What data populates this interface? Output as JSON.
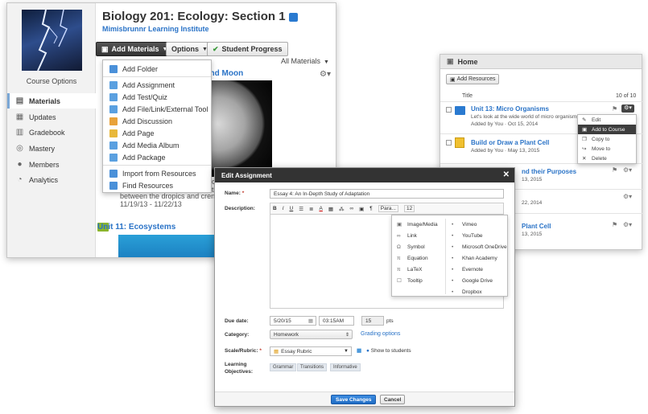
{
  "course": {
    "title": "Biology 201: Ecology: Section 1",
    "school": "Mimisbrunnr Learning Institute",
    "options_label": "Course Options",
    "nav": [
      {
        "label": "Materials",
        "icon": "materials-icon"
      },
      {
        "label": "Updates",
        "icon": "updates-icon"
      },
      {
        "label": "Gradebook",
        "icon": "gradebook-icon"
      },
      {
        "label": "Mastery",
        "icon": "mastery-icon"
      },
      {
        "label": "Members",
        "icon": "members-icon"
      },
      {
        "label": "Analytics",
        "icon": "analytics-icon"
      }
    ],
    "toolbar": {
      "add_materials": "Add Materials",
      "options": "Options",
      "student_progress": "Student Progress",
      "filter": "All Materials"
    },
    "add_menu": [
      {
        "label": "Add Folder",
        "color": "#4a90d9"
      },
      {
        "label": "Add Assignment",
        "color": "#5aa0e0"
      },
      {
        "label": "Add Test/Quiz",
        "color": "#5aa0e0"
      },
      {
        "label": "Add File/Link/External Tool",
        "color": "#5aa0e0"
      },
      {
        "label": "Add Discussion",
        "color": "#e8a23a"
      },
      {
        "label": "Add Page",
        "color": "#e8b83a"
      },
      {
        "label": "Add Media Album",
        "color": "#5aa0e0"
      },
      {
        "label": "Add Package",
        "color": "#5aa0e0"
      },
      {
        "label": "Import from Resources",
        "color": "#4a90d9"
      },
      {
        "label": "Find Resources",
        "color": "#4a90d9"
      }
    ],
    "moon_title_fragment": "and Moon",
    "date_fragment": "11/19/13 - 11/22/13",
    "cycle_fragment": "cycle",
    "ts_fragment": "ts",
    "between_fragment": "between the dropics and  crenation",
    "unit11": "Unit 11: Ecosystems"
  },
  "home": {
    "title": "Home",
    "add_resources": "Add Resources",
    "col_title": "Title",
    "count": "10 of 10",
    "items": [
      {
        "title": "Unit 13: Micro Organisms",
        "desc": "Let's look at the wide world of micro organisms!",
        "meta": "Added by You · Oct 15, 2014"
      },
      {
        "title": "Build or Draw a Plant Cell",
        "meta": "Added by You · May 13, 2015"
      },
      {
        "title": "nd their Purposes",
        "meta": "13, 2015"
      },
      {
        "title": "Plant Cell",
        "meta": "13, 2015"
      }
    ],
    "frag_22": "22, 2014",
    "context_menu": [
      {
        "label": "Edit",
        "icon": "✎"
      },
      {
        "label": "Add to Course",
        "icon": "▣"
      },
      {
        "label": "Copy to",
        "icon": "❐"
      },
      {
        "label": "Move to",
        "icon": "↪"
      },
      {
        "label": "Delete",
        "icon": "✕"
      }
    ]
  },
  "edit": {
    "title": "Edit Assignment",
    "name_label": "Name:",
    "name_value": "Essay 4: An In-Depth Study of Adaptation",
    "desc_label": "Description:",
    "toolbar": [
      "B",
      "I",
      "U",
      "☰",
      "≣",
      "A",
      "▦",
      "⁂",
      "∞",
      "▣",
      "¶",
      "Para...",
      "12"
    ],
    "insert_left": [
      {
        "label": "Image/Media",
        "icon": "▣"
      },
      {
        "label": "Link",
        "icon": "∞"
      },
      {
        "label": "Symbol",
        "icon": "Ω"
      },
      {
        "label": "Equation",
        "icon": "π"
      },
      {
        "label": "LaTeX",
        "icon": "π"
      },
      {
        "label": "Tooltip",
        "icon": "☐"
      }
    ],
    "insert_right": [
      {
        "label": "Vimeo"
      },
      {
        "label": "YouTube"
      },
      {
        "label": "Microsoft OneDrive"
      },
      {
        "label": "Khan Academy"
      },
      {
        "label": "Evernote"
      },
      {
        "label": "Google Drive"
      },
      {
        "label": "Dropbox"
      }
    ],
    "due_label": "Due date:",
    "due_date": "5/20/15",
    "due_time": "03:15AM",
    "points": "15",
    "pts_label": "pts",
    "category_label": "Category:",
    "category": "Homework",
    "grading_options": "Grading options",
    "scale_label": "Scale/Rubric:",
    "rubric": "Essay Rubric",
    "show_students": "Show to students",
    "objectives_label_1": "Learning",
    "objectives_label_2": "Objectives:",
    "objectives": [
      "Grammar",
      "Transitions",
      "Informative"
    ],
    "save": "Save Changes",
    "cancel": "Cancel"
  }
}
